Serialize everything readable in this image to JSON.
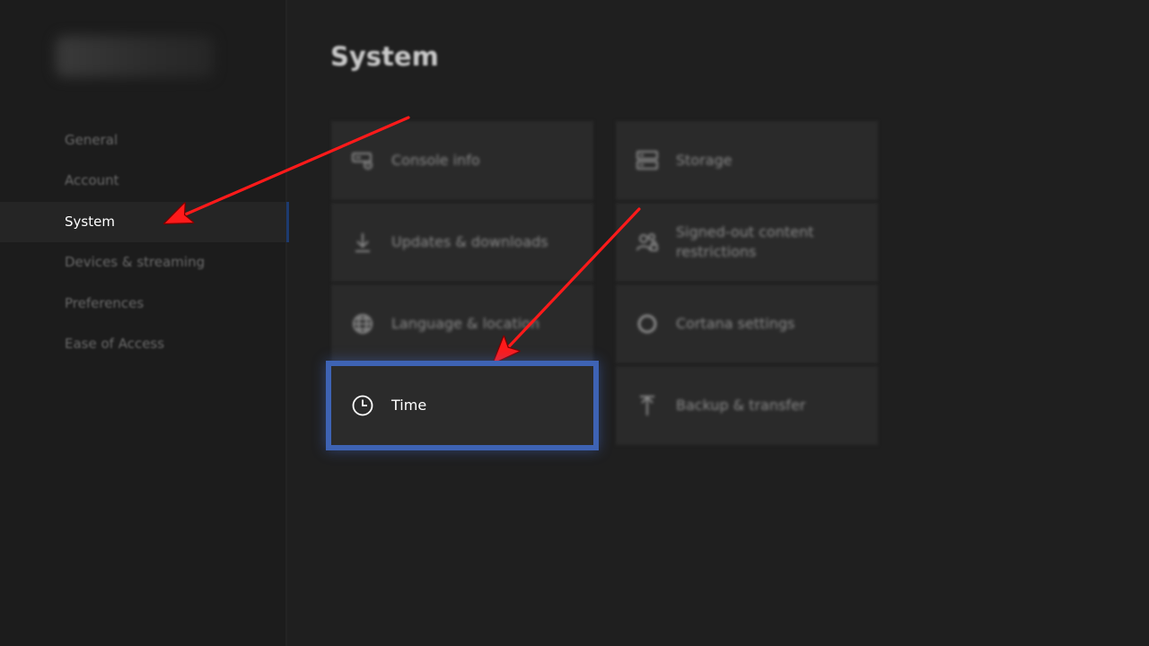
{
  "sidebar": {
    "items": [
      {
        "label": "General",
        "active": false
      },
      {
        "label": "Account",
        "active": false
      },
      {
        "label": "System",
        "active": true
      },
      {
        "label": "Devices & streaming",
        "active": false
      },
      {
        "label": "Preferences",
        "active": false
      },
      {
        "label": "Ease of Access",
        "active": false
      }
    ]
  },
  "main": {
    "title": "System",
    "tiles": [
      {
        "label": "Console info",
        "icon": "console-icon"
      },
      {
        "label": "Storage",
        "icon": "storage-icon"
      },
      {
        "label": "Updates & downloads",
        "icon": "download-icon"
      },
      {
        "label": "Signed-out content restrictions",
        "icon": "people-lock-icon"
      },
      {
        "label": "Language & location",
        "icon": "globe-icon"
      },
      {
        "label": "Cortana settings",
        "icon": "cortana-icon"
      },
      {
        "label": "Time",
        "icon": "clock-icon",
        "focused": true
      },
      {
        "label": "Backup & transfer",
        "icon": "upload-icon"
      }
    ]
  },
  "colors": {
    "focus_outline": "#3e63b4",
    "arrow": "#ff1a1a",
    "background": "#1f1f1f",
    "tile": "#2a2a2a"
  }
}
